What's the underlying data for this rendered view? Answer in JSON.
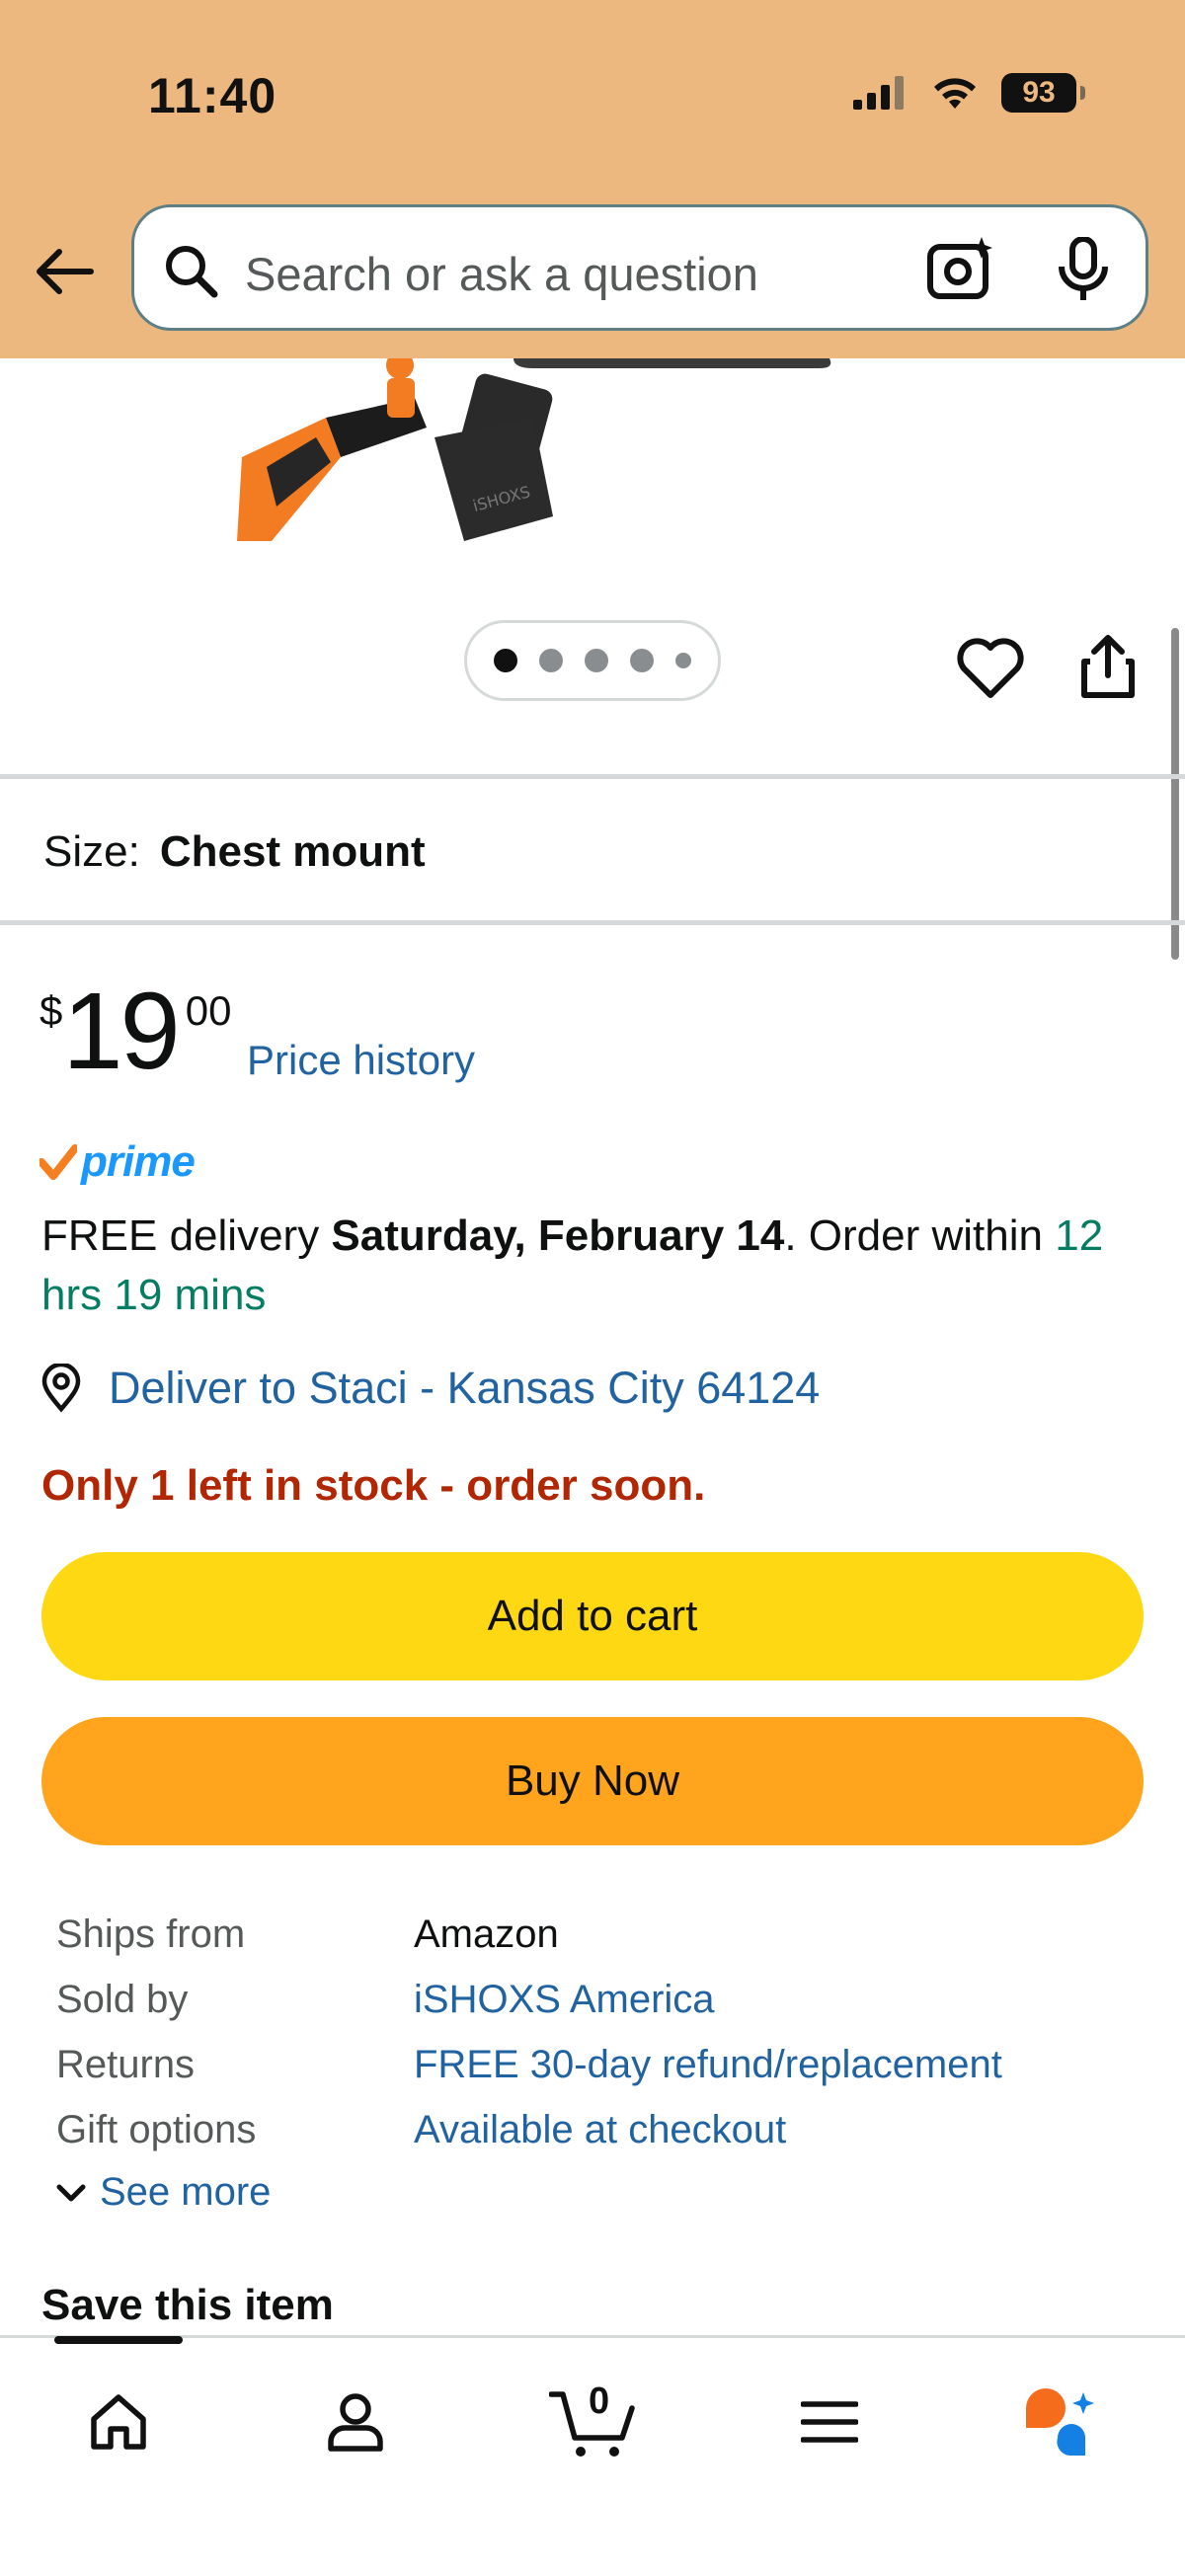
{
  "status_bar": {
    "time": "11:40",
    "battery": "93"
  },
  "search": {
    "placeholder": "Search or ask a question"
  },
  "gallery": {
    "dot_count": 5,
    "active_index": 0
  },
  "size": {
    "label": "Size:",
    "value": "Chest mount"
  },
  "price": {
    "symbol": "$",
    "whole": "19",
    "fraction": "00",
    "history_link": "Price history"
  },
  "prime": {
    "label": "prime"
  },
  "delivery": {
    "prefix": "FREE delivery ",
    "date": "Saturday, February 14",
    "middle": ". Order within ",
    "countdown": "12 hrs 19 mins"
  },
  "deliver_to": "Deliver to Staci - Kansas City 64124",
  "stock_message": "Only 1 left in stock - order soon.",
  "buttons": {
    "add_to_cart": "Add to cart",
    "buy_now": "Buy Now"
  },
  "details": [
    {
      "key": "Ships from",
      "value": "Amazon",
      "link": false
    },
    {
      "key": "Sold by",
      "value": "iSHOXS America",
      "link": true
    },
    {
      "key": "Returns",
      "value": "FREE 30-day refund/replacement",
      "link": true
    },
    {
      "key": "Gift options",
      "value": "Available at checkout",
      "link": true
    }
  ],
  "see_more": "See more",
  "save_item": "Save this item",
  "cart_count": "0",
  "colors": {
    "header": "#edb880",
    "link": "#2162a1",
    "add_to_cart": "#ffd814",
    "buy_now": "#ffa41c",
    "stock": "#b12704",
    "countdown": "#067d62"
  }
}
